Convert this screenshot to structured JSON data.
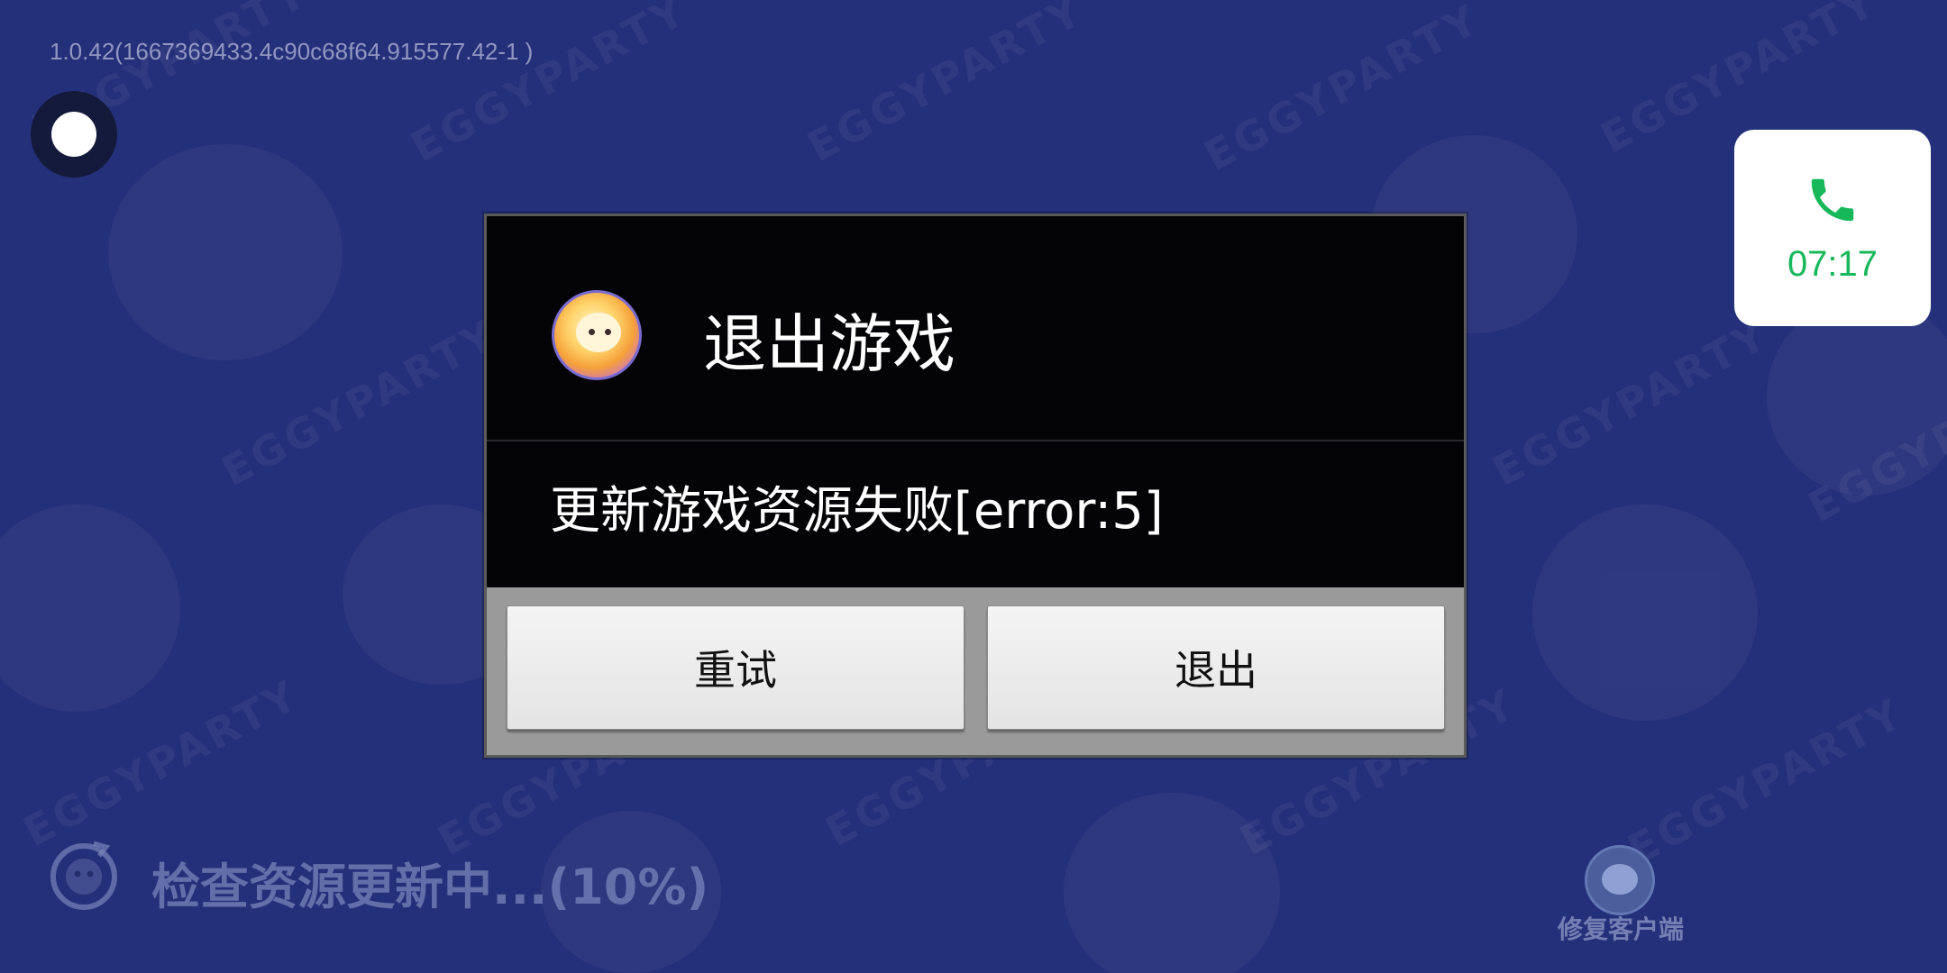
{
  "status": {
    "version": "1.0.42(1667369433.4c90c68f64.915577.42-1 )"
  },
  "call_widget": {
    "time": "07:17",
    "accent_color": "#17b85a"
  },
  "dialog": {
    "title": "退出游戏",
    "message": "更新游戏资源失败[error:5]",
    "retry_label": "重试",
    "exit_label": "退出"
  },
  "loading": {
    "text": "检查资源更新中...(10%)",
    "progress_percent": 10
  },
  "repair": {
    "label": "修复客户端"
  },
  "background": {
    "watermark_text": "EGGYPARTY"
  },
  "colors": {
    "background": "#25307a",
    "dialog_dark": "#040406",
    "button_face": "#eeeeee"
  }
}
